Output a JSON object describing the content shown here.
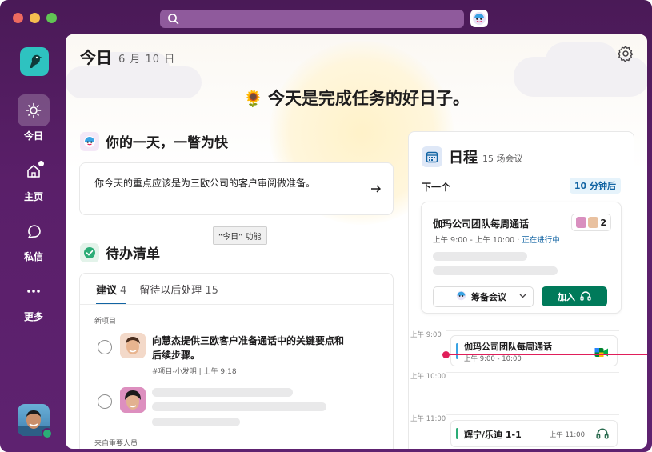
{
  "sidebar": {
    "items": [
      {
        "label": "今日",
        "icon": "sun-icon",
        "active": true
      },
      {
        "label": "主页",
        "icon": "home-icon"
      },
      {
        "label": "私信",
        "icon": "dm-icon"
      },
      {
        "label": "更多",
        "icon": "more-icon"
      }
    ]
  },
  "header": {
    "title": "今日",
    "date": "6 月 10 日"
  },
  "hero": {
    "text": "今天是完成任务的好日子。"
  },
  "summary": {
    "heading": "你的一天，一瞥为快",
    "text": "你今天的重点应该是为三欧公司的客户审阅做准备。"
  },
  "tooltip": {
    "text": "“今日” 功能"
  },
  "todo": {
    "heading": "待办清单",
    "tabs": [
      {
        "label": "建议",
        "count": "4"
      },
      {
        "label": "留待以后处理",
        "count": "15"
      }
    ],
    "group_new": "新项目",
    "group_important": "来自重要人员",
    "task": {
      "title": "向慧杰提供三欧客户准备通话中的关键要点和后续步骤。",
      "meta": "#项目-小发明 | 上午 9:18"
    }
  },
  "schedule": {
    "title": "日程",
    "count": "15 场会议",
    "next_label": "下一个",
    "next_badge": "10 分钟后",
    "next_meeting": {
      "title": "伽玛公司团队每周通话",
      "time": "上午 9:00 - 上午 10:00 · ",
      "live": "正在进行中",
      "people_count": "2",
      "huddle_label": "筹备会议",
      "join_label": "加入"
    },
    "hours": [
      "上午 9:00",
      "上午 10:00",
      "上午 11:00"
    ],
    "events": [
      {
        "title": "伽玛公司团队每周通话",
        "sub": "上午 9:00 - 10:00"
      },
      {
        "title": "辉宁/乐迪 1-1",
        "time": "上午 11:00"
      }
    ]
  },
  "colors": {
    "sidebar": "#5a1f69",
    "accent": "#1264a3",
    "join": "#007a5a",
    "now_line": "#e01e5a"
  }
}
